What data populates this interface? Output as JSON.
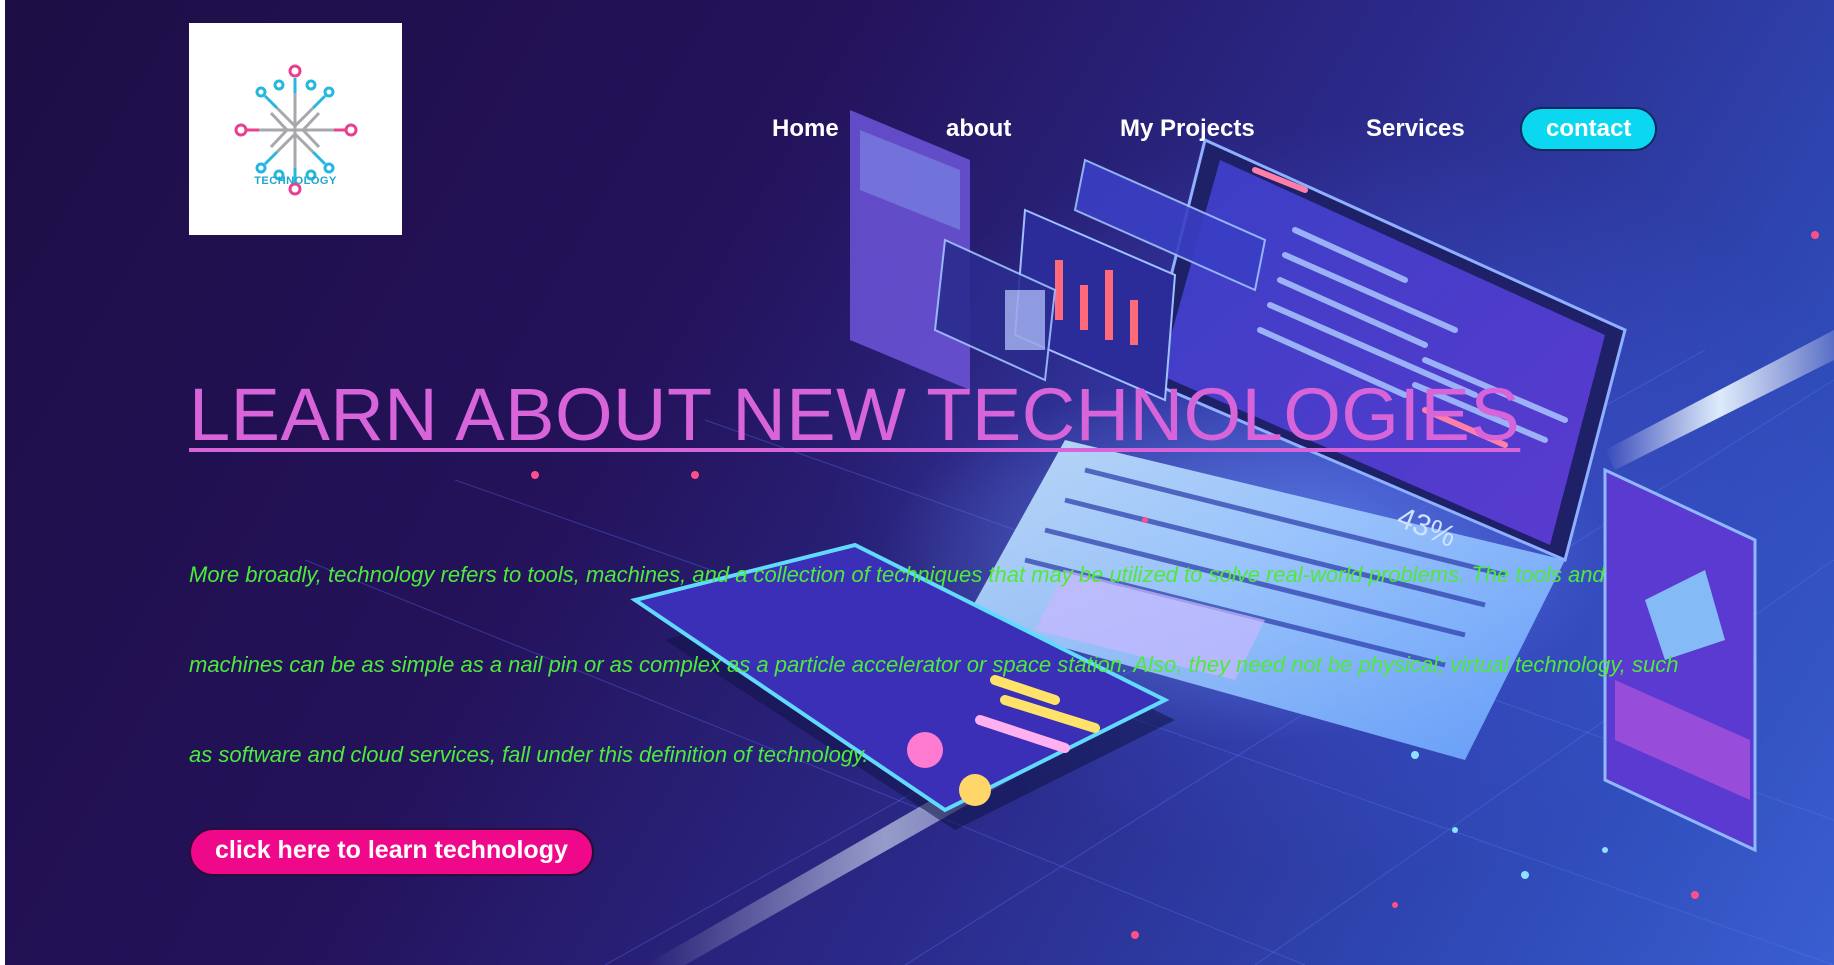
{
  "logo": {
    "text": "TECHNOLOGY"
  },
  "nav": {
    "home": "Home",
    "about": "about",
    "projects": "My Projects",
    "services": "Services",
    "contact": "contact"
  },
  "hero": {
    "title": "LEARN ABOUT NEW TECHNOLOGIES",
    "description": "More broadly, technology refers to tools, machines, and a collection of techniques that may be utilized to solve real-world problems. The tools and machines can be as simple as a nail pin or as complex as a particle accelerator or space station. Also, they need not be physical; virtual technology, such as software and cloud services, fall under this definition of technology.",
    "cta": "click here to learn technology",
    "badge": "43%"
  },
  "colors": {
    "title": "#d764d8",
    "description": "#4dea3c",
    "contact_button": "#0bd8f0",
    "cta_button": "#f0088a"
  }
}
